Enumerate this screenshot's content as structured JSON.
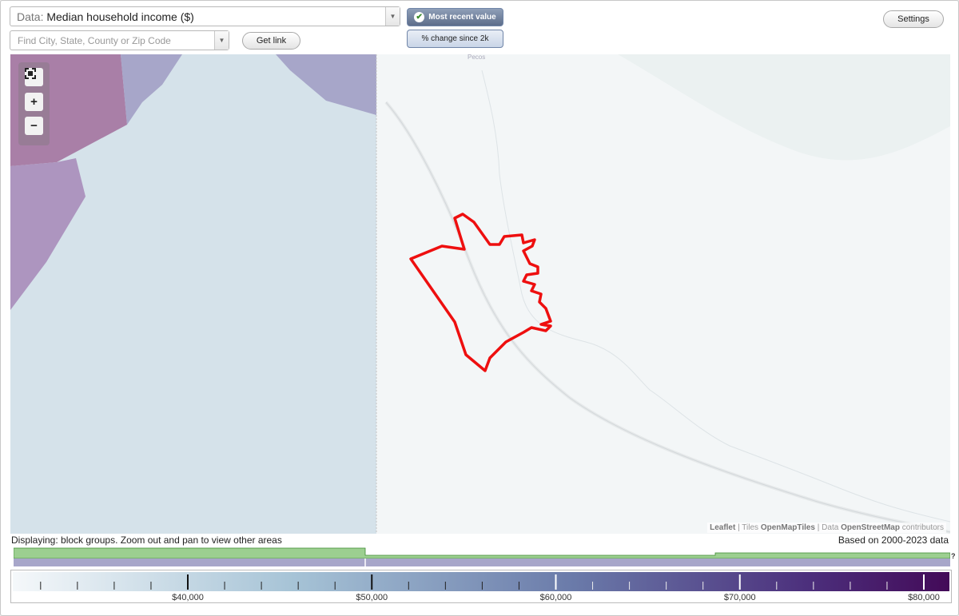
{
  "controls": {
    "data_label": "Data:",
    "data_value": "Median household income ($)",
    "search_placeholder": "Find City, State, County or Zip Code",
    "get_link": "Get link",
    "settings": "Settings",
    "toggle_recent": "Most recent value",
    "toggle_change": "% change since 2k"
  },
  "map": {
    "place_label": "Pecos",
    "attribution": {
      "leaflet": "Leaflet",
      "sep1": " | Tiles ",
      "tiles": "OpenMapTiles",
      "sep2": " | Data ",
      "osm": "OpenStreetMap",
      "contributors": " contributors"
    },
    "colors": {
      "left_region": "#d5e2ea",
      "purple_dark": "#a97fa7",
      "purple_light": "#a7a6c9",
      "boundary": "#ee0f0f",
      "base": "#f3f6f7"
    }
  },
  "footer": {
    "displaying": "Displaying: block groups. Zoom out and pan to view other areas",
    "based_on": "Based on 2000-2023 data",
    "help_mark": "?"
  },
  "legend": {
    "ticks": [
      "$40,000",
      "$50,000",
      "$60,000",
      "$70,000",
      "$80,000"
    ],
    "tick_values": [
      40000,
      50000,
      60000,
      70000,
      80000
    ],
    "gradient": [
      "#f5f8fa",
      "#a6c3d6",
      "#6a7aa9",
      "#4c2f7c",
      "#430a58"
    ]
  },
  "icons": {
    "fit_bounds": "fullscreen-icon",
    "zoom_in": "plus-icon",
    "zoom_out": "minus-icon",
    "check": "check-icon",
    "dropdown": "chevron-down-icon"
  }
}
